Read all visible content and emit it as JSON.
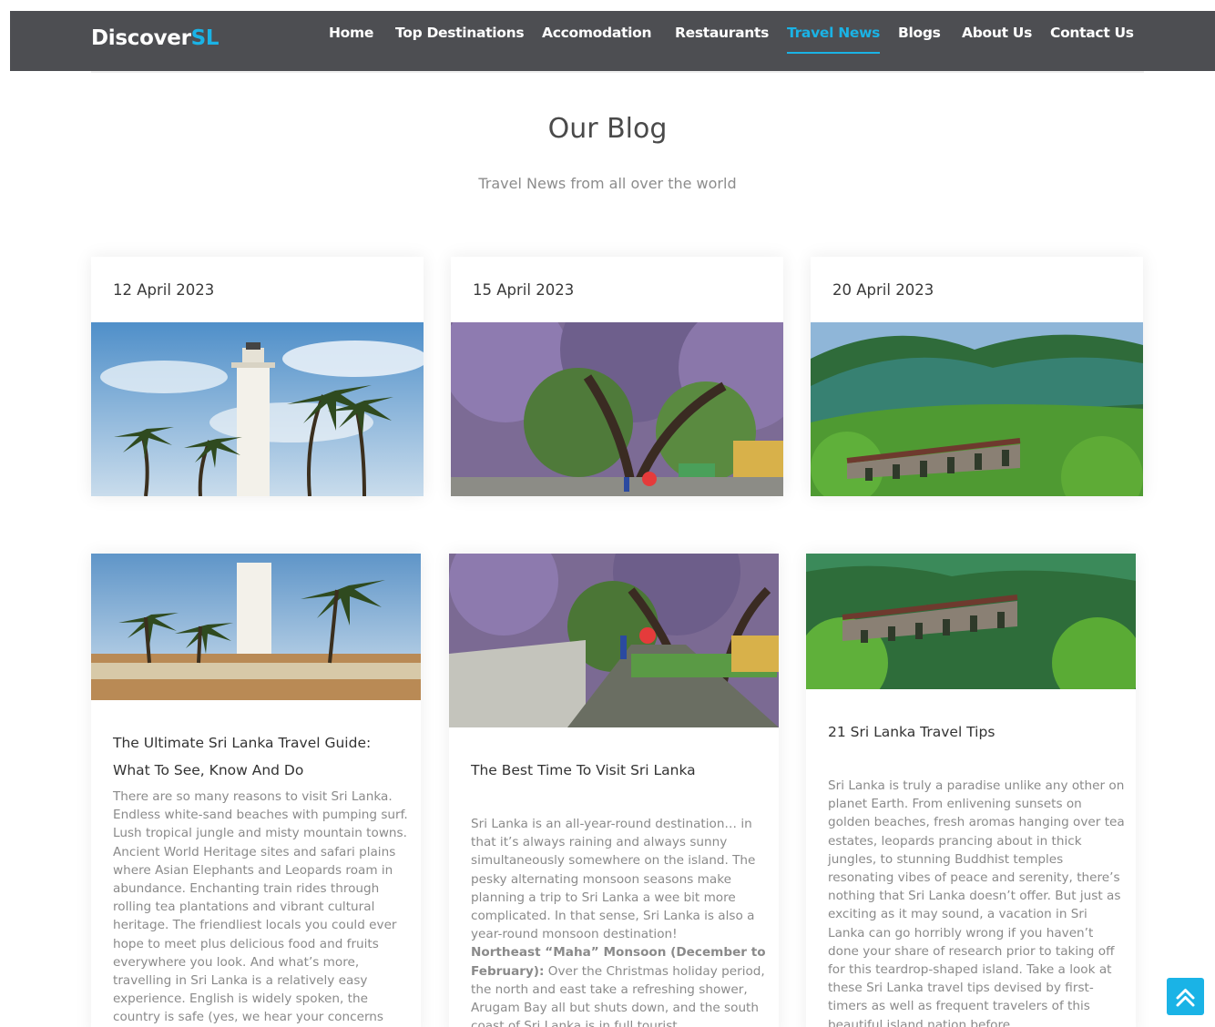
{
  "brand": {
    "name_main": "Discover",
    "name_accent": "SL"
  },
  "nav": {
    "items": [
      {
        "label": "Home"
      },
      {
        "label": "Top Destinations"
      },
      {
        "label": "Accomodation"
      },
      {
        "label": "Restaurants"
      },
      {
        "label": "Travel News",
        "active": true
      },
      {
        "label": "Blogs"
      },
      {
        "label": "About Us"
      },
      {
        "label": "Contact Us"
      }
    ]
  },
  "blog": {
    "title": "Our Blog",
    "subtitle": "Travel News from all over the world"
  },
  "news_cards": [
    {
      "date": "12 April 2023",
      "image": "lighthouse-palms-photo"
    },
    {
      "date": "15 April 2023",
      "image": "jacaranda-street-photo"
    },
    {
      "date": "20 April 2023",
      "image": "nine-arches-bridge-photo"
    }
  ],
  "posts": [
    {
      "title": "The Ultimate Sri Lanka Travel Guide: What To See, Know And Do",
      "body": "There are so many reasons to visit Sri Lanka. Endless white-sand beaches with pumping surf. Lush tropical jungle and misty mountain towns. Ancient World Heritage sites and safari plains where Asian Elephants and Leopards roam in abundance. Enchanting train rides through rolling tea plantations and vibrant cultural heritage. The friendliest locals you could ever hope to meet plus delicious food and fruits everywhere you look. And what’s more, travelling in Sri Lanka is a relatively easy experience. English is widely spoken, the country is safe (yes, we hear your concerns"
    },
    {
      "title": "The Best Time To Visit Sri Lanka",
      "body": "Sri Lanka is an all-year-round destination… in that it’s always raining and always sunny simultaneously somewhere on the island. The pesky alternating monsoon seasons make planning a trip to Sri Lanka a wee bit more complicated. In that sense, Sri Lanka is also a year-round monsoon destination!",
      "body_bold": "Northeast “Maha” Monsoon (December to February):",
      "body_cont": " Over the Christmas holiday period, the north and east take a refreshing shower, Arugam Bay all but shuts down, and the south coast of Sri Lanka is in full tourist"
    },
    {
      "title": "21 Sri Lanka Travel Tips",
      "body": "Sri Lanka is truly a paradise unlike any other on planet Earth. From enlivening sunsets on golden beaches, fresh aromas hanging over tea estates, leopards prancing about in thick jungles, to stunning Buddhist temples resonating vibes of peace and serenity, there’s nothing that Sri Lanka doesn’t offer. But just as exciting as it may sound, a vacation in Sri Lanka can go horribly wrong if you haven’t done your share of research prior to taking off for this teardrop-shaped island. Take a look at these Sri Lanka travel tips devised by first-timers as well as frequent travelers of this beautiful island nation before"
    }
  ],
  "scroll_top": {
    "icon": "double-chevron-up-icon"
  },
  "colors": {
    "navbar": "#4d4e52",
    "accent": "#1ab3e6"
  }
}
